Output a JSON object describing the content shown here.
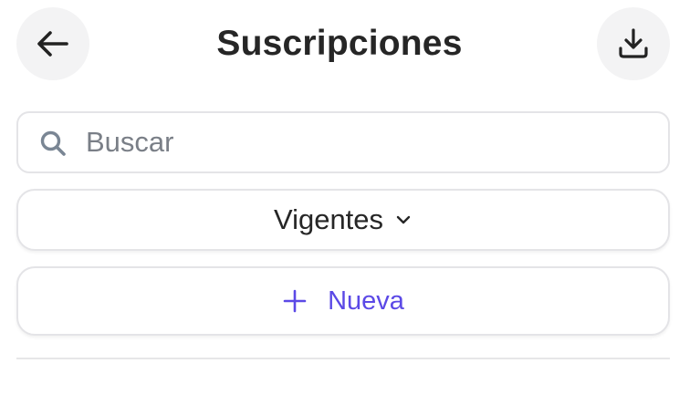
{
  "header": {
    "title": "Suscripciones",
    "back_icon": "arrow-left-icon",
    "download_icon": "download-icon"
  },
  "search": {
    "placeholder": "Buscar",
    "value": "",
    "icon": "search-icon"
  },
  "filter": {
    "selected": "Vigentes",
    "icon": "chevron-down-icon"
  },
  "new_button": {
    "label": "Nueva",
    "icon": "plus-icon"
  },
  "colors": {
    "accent": "#5b49e6",
    "circle_bg": "#f3f3f4",
    "border": "#e4e4e7",
    "placeholder": "#7a7f87"
  }
}
